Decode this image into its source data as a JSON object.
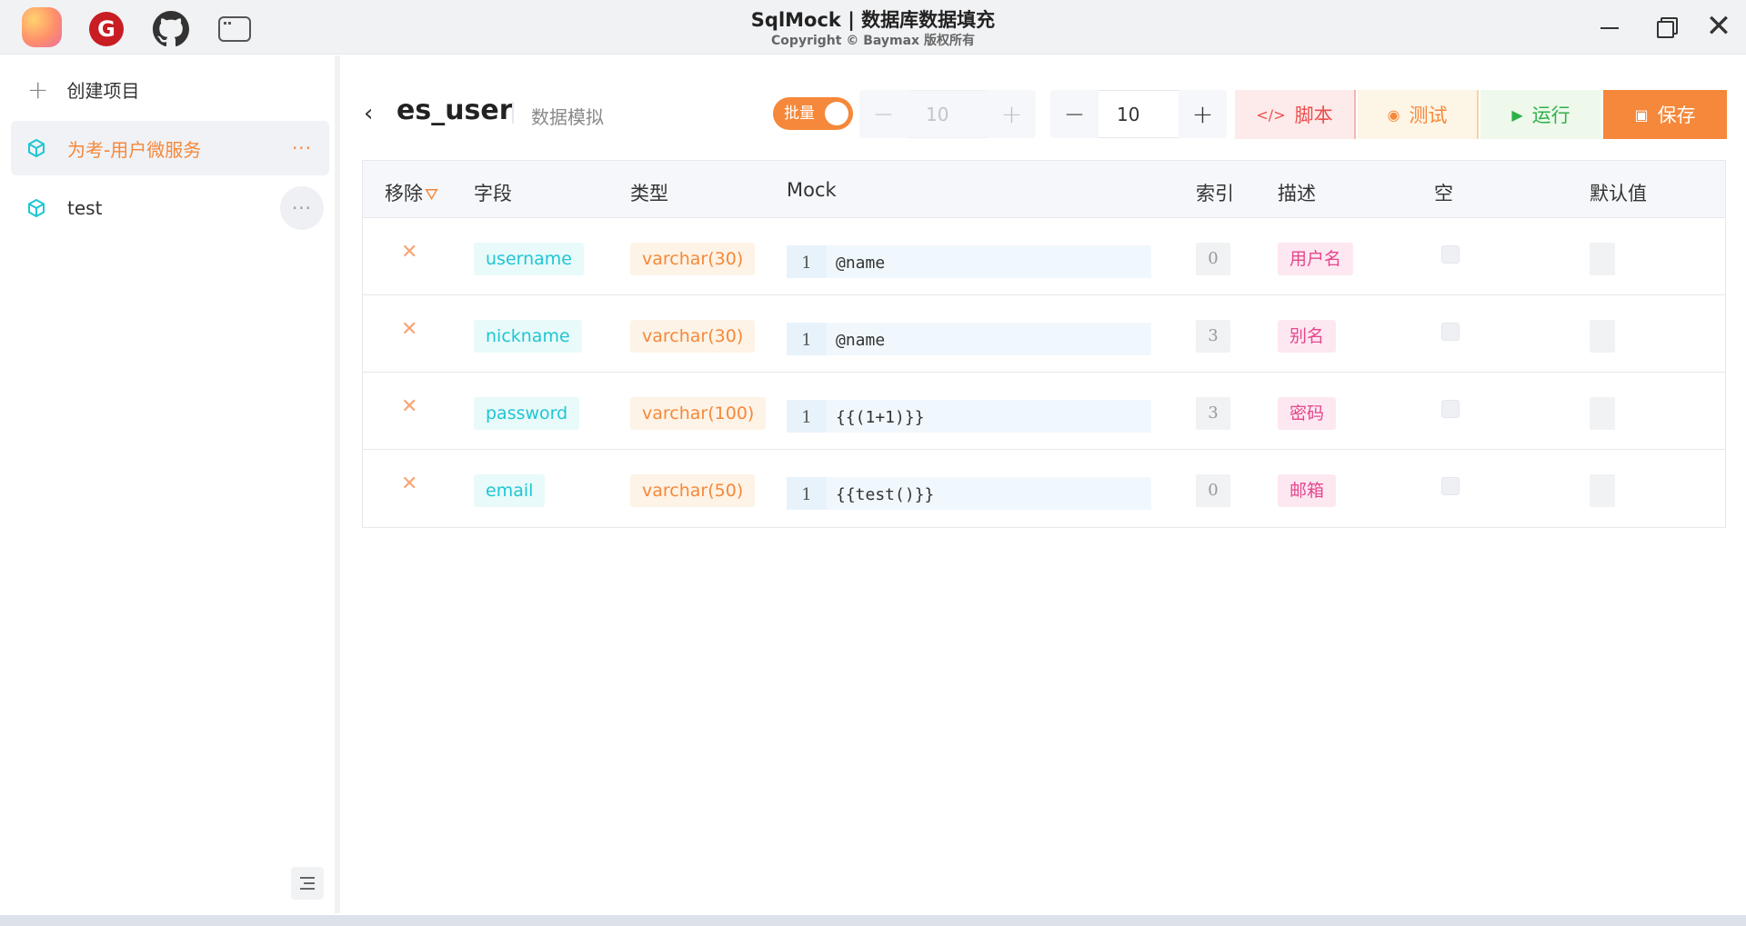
{
  "app": {
    "title": "SqlMock | 数据库数据填充",
    "subtitle": "Copyright © Baymax 版权所有",
    "icons": [
      "app-logo-icon",
      "gitee-icon",
      "github-icon",
      "window-icon"
    ],
    "gitee_letter": "G",
    "close_glyph": "✕"
  },
  "sidebar": {
    "create_label": "创建项目",
    "projects": [
      {
        "name": "为考-用户微服务",
        "active": true,
        "more": "···"
      },
      {
        "name": "test",
        "active": false,
        "more": "···"
      }
    ]
  },
  "header": {
    "back_glyph": "‹",
    "table_name": "es_user",
    "subtitle": "数据模拟",
    "batch_label": "批量",
    "batch_enabled": true,
    "stepper_disabled_value": "10",
    "stepper_value": "10",
    "minus": "−",
    "plus": "+",
    "buttons": {
      "script": "脚本",
      "test": "测试",
      "run": "运行",
      "save": "保存"
    }
  },
  "colors": {
    "accent": "#f5883a",
    "cyan": "#1fc6d3",
    "pink": "#e5478c",
    "red": "#ee4d4d",
    "green": "#2fb14a"
  },
  "table": {
    "columns": [
      "移除",
      "字段",
      "类型",
      "Mock",
      "索引",
      "描述",
      "空",
      "默认值"
    ],
    "rows": [
      {
        "field": "username",
        "type": "varchar(30)",
        "line": "1",
        "mock": "@name",
        "index": "0",
        "desc": "用户名",
        "nullable": false
      },
      {
        "field": "nickname",
        "type": "varchar(30)",
        "line": "1",
        "mock": "@name",
        "index": "3",
        "desc": "别名",
        "nullable": false
      },
      {
        "field": "password",
        "type": "varchar(100)",
        "line": "1",
        "mock": "{{(1+1)}}",
        "index": "3",
        "desc": "密码",
        "nullable": false
      },
      {
        "field": "email",
        "type": "varchar(50)",
        "line": "1",
        "mock": "{{test()}}",
        "index": "0",
        "desc": "邮箱",
        "nullable": false
      }
    ]
  }
}
